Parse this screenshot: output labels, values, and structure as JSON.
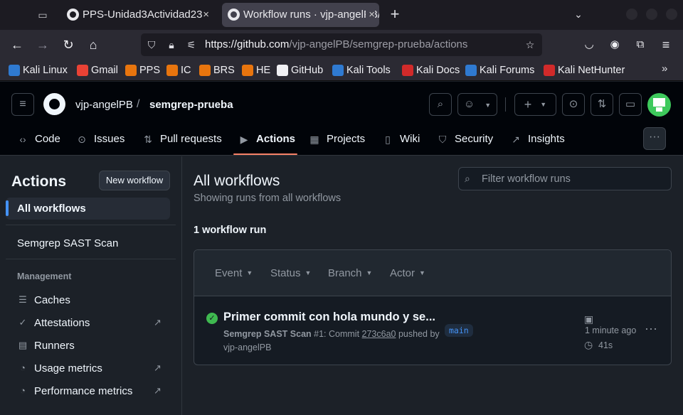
{
  "browser": {
    "tabs": [
      {
        "label": "PPS-Unidad3Actividad23",
        "close": "×"
      },
      {
        "label": "Workflow runs · vjp-angelPB/semgrep-prueba",
        "close": "×"
      }
    ],
    "new_tab": "+",
    "tab_list": "⌄",
    "url_domain": "https://github.com",
    "url_path": "/vjp-angelPB/semgrep-prueba/actions",
    "bookmarks": [
      {
        "label": "Kali Linux",
        "color": "#2f7ad1"
      },
      {
        "label": "Gmail",
        "color": "#e94235"
      },
      {
        "label": "PPS",
        "color": "#e8750e"
      },
      {
        "label": "IC",
        "color": "#e8750e"
      },
      {
        "label": "BRS",
        "color": "#e8750e"
      },
      {
        "label": "HE",
        "color": "#e8750e"
      },
      {
        "label": "GitHub",
        "color": "#f0f0f4"
      },
      {
        "label": "Kali Tools",
        "color": "#2f7ad1"
      },
      {
        "label": "Kali Docs",
        "color": "#d12a2a"
      },
      {
        "label": "Kali Forums",
        "color": "#2f7ad1"
      },
      {
        "label": "Kali NetHunter",
        "color": "#d12a2a"
      }
    ]
  },
  "header": {
    "owner": "vjp-angelPB",
    "separator": "/",
    "repo": "semgrep-prueba",
    "nav": [
      {
        "label": "Code",
        "icon": "code-icon"
      },
      {
        "label": "Issues",
        "icon": "issue-icon"
      },
      {
        "label": "Pull requests",
        "icon": "pull-request-icon"
      },
      {
        "label": "Actions",
        "icon": "play-icon"
      },
      {
        "label": "Projects",
        "icon": "table-icon"
      },
      {
        "label": "Wiki",
        "icon": "book-icon"
      },
      {
        "label": "Security",
        "icon": "shield-icon"
      },
      {
        "label": "Insights",
        "icon": "graph-icon"
      }
    ],
    "more": "···"
  },
  "sidebar": {
    "title": "Actions",
    "new_workflow": "New workflow",
    "all_workflows": "All workflows",
    "workflows": [
      "Semgrep SAST Scan"
    ],
    "management_heading": "Management",
    "management": [
      {
        "label": "Caches",
        "icon": "database-icon",
        "external": false
      },
      {
        "label": "Attestations",
        "icon": "verified-icon",
        "external": true
      },
      {
        "label": "Runners",
        "icon": "server-icon",
        "external": false
      },
      {
        "label": "Usage metrics",
        "icon": "meter-icon",
        "external": true
      },
      {
        "label": "Performance metrics",
        "icon": "meter-icon",
        "external": true
      }
    ]
  },
  "main": {
    "title": "All workflows",
    "subtitle": "Showing runs from all workflows",
    "filter_placeholder": "Filter workflow runs",
    "run_count": "1 workflow run",
    "filters": [
      "Event",
      "Status",
      "Branch",
      "Actor"
    ],
    "runs": [
      {
        "title": "Primer commit con hola mundo y se...",
        "workflow": "Semgrep SAST Scan",
        "run_number": "#1: Commit",
        "sha": "273c6a0",
        "pushed_by": "pushed by",
        "actor": "vjp-angelPB",
        "branch": "main",
        "time_ago": "1 minute ago",
        "duration": "41s",
        "status": "success"
      }
    ]
  },
  "colors": {
    "accent_underline": "#f78166",
    "success": "#3fb950",
    "link": "#4493f8"
  }
}
